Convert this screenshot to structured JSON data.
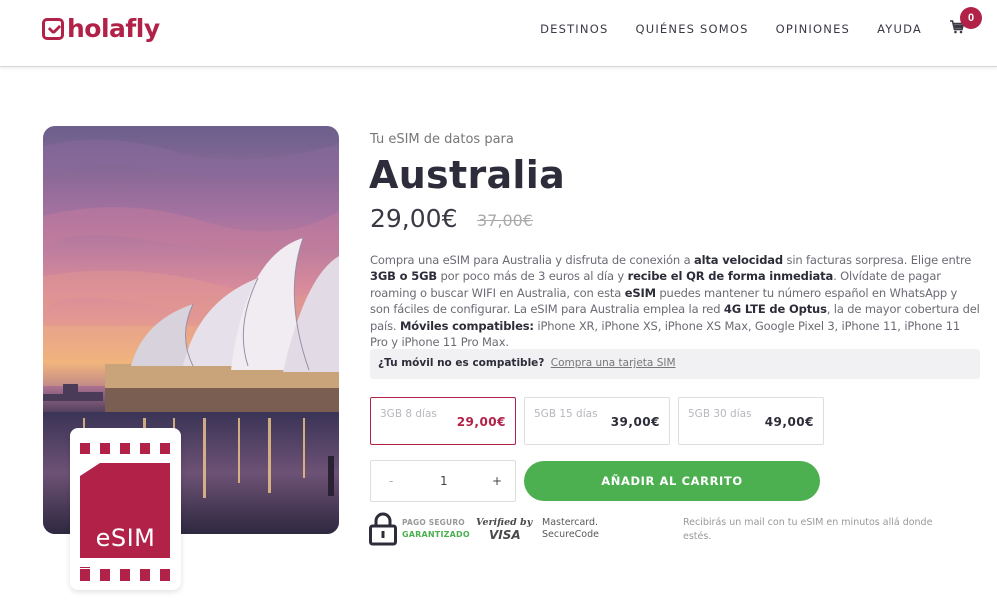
{
  "header": {
    "logo_text": "holafly",
    "nav": [
      "DESTINOS",
      "QUIÉNES SOMOS",
      "OPINIONES",
      "AYUDA"
    ],
    "cart_count": "0",
    "brand_color": "#b22248"
  },
  "hero": {
    "esim_label": "eSIM"
  },
  "product": {
    "pre_title": "Tu eSIM de datos para",
    "title": "Australia",
    "price": "29,00€",
    "old_price": "37,00€",
    "description": {
      "p1": "Compra una eSIM para Australia y disfruta de conexión a ",
      "b1": "alta velocidad",
      "p2": " sin facturas sorpresa. Elige entre ",
      "b2": "3GB o 5GB",
      "p3": " por poco más de 3 euros al día y ",
      "b3": "recibe el QR de forma inmediata",
      "p4": ". Olvídate de pagar roaming o buscar WIFI en Australia, con esta ",
      "b4": "eSIM",
      "p5": " puedes mantener tu número español en WhatsApp y son fáciles de configurar. La eSIM para Australia emplea la red ",
      "b5": "4G LTE de Optus",
      "p6": ", la de mayor cobertura del país. ",
      "b6": "Móviles compatibles:",
      "p7": " iPhone XR, iPhone XS, iPhone XS Max, Google Pixel 3, iPhone 11, iPhone 11 Pro y iPhone 11 Pro Max."
    },
    "compat_question": "¿Tu móvil no es compatible?",
    "compat_link": "Compra una tarjeta SIM",
    "plans": [
      {
        "name": "3GB 8 días",
        "price": "29,00€",
        "selected": true
      },
      {
        "name": "5GB 15 días",
        "price": "39,00€",
        "selected": false
      },
      {
        "name": "5GB 30 días",
        "price": "49,00€",
        "selected": false
      }
    ],
    "quantity": {
      "minus": "-",
      "value": "1",
      "plus": "+"
    },
    "add_to_cart": "AÑADIR AL CARRITO",
    "add_color": "#4caf50"
  },
  "payment": {
    "secure_line1": "PAGO SEGURO",
    "secure_line2": "GARANTIZADO",
    "visa_line1": "Verified by",
    "visa_line2": "VISA",
    "mc_line1": "Mastercard.",
    "mc_line2": "SecureCode",
    "email_note": "Recibirás un mail con tu eSIM en minutos allá donde estés."
  }
}
